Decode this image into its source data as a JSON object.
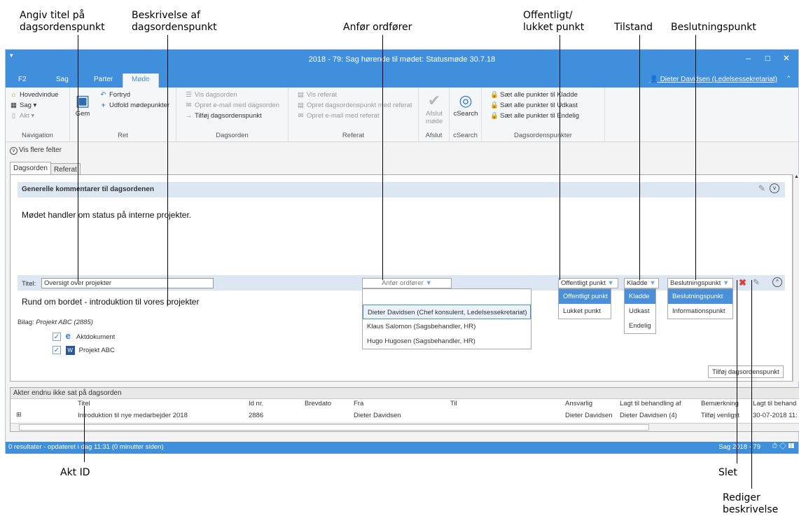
{
  "callouts": {
    "titel": "Angiv titel på\ndagsordenspunkt",
    "beskrivelse": "Beskrivelse af\ndagsordenspunkt",
    "ordforer": "Anfør ordfører",
    "offentligt": "Offentligt/\nlukket punkt",
    "tilstand": "Tilstand",
    "beslutning": "Beslutningspunkt",
    "aktid": "Akt ID",
    "slet": "Slet",
    "rediger": "Rediger\nbeskrivelse"
  },
  "window": {
    "title": "2018 - 79: Sag hørende til mødet: Statusmøde 30.7.18",
    "user": "Dieter Davidsen (Ledelsessekretariat)"
  },
  "tabs": [
    "F2",
    "Sag",
    "Parter",
    "Møde"
  ],
  "ribbon": {
    "navigation": {
      "title": "Navigation",
      "items": [
        "Hovedvindue",
        "Sag ▾",
        "Akt ▾"
      ]
    },
    "ret": {
      "title": "Ret",
      "gem": "Gem",
      "fortryd": "Fortryd",
      "udfold": "Udfold mødepunkter"
    },
    "dagsorden": {
      "title": "Dagsorden",
      "items": [
        "Vis dagsorden",
        "Opret e-mail med dagsorden",
        "Tilføj dagsordenspunkt"
      ]
    },
    "referat": {
      "title": "Referat",
      "items": [
        "Vis referat",
        "Opret dagsordenspunkt med referat",
        "Opret e-mail med referat"
      ]
    },
    "afslut": {
      "title": "Afslut",
      "label1": "Afslut",
      "label2": "møde"
    },
    "csearch": {
      "title": "cSearch",
      "label": "cSearch"
    },
    "punkter": {
      "title": "Dagsordenspunkter",
      "items": [
        "Sæt alle punkter til Kladde",
        "Sæt alle punkter til Udkast",
        "Sæt alle punkter til Endelig"
      ]
    }
  },
  "more_fields": "Vis flere felter",
  "doc_tabs": [
    "Dagsorden",
    "Referat"
  ],
  "general": {
    "header": "Generelle kommentarer til dagsordenen",
    "text": "Mødet handler om status på interne projekter."
  },
  "item": {
    "title_label": "Titel:",
    "title_value": "Oversigt over projekter",
    "ordforer_placeholder": "Anfør ordfører",
    "ordforer_options": [
      "Dieter Davidsen (Chef konsulent, Ledelsessekretariat)",
      "Klaus Salomon (Sagsbehandler, HR)",
      "Hugo Hugosen (Sagsbehandler, HR)"
    ],
    "public_selected": "Offentligt punkt",
    "public_options": [
      "Offentligt punkt",
      "Lukket punkt"
    ],
    "state_selected": "Kladde",
    "state_options": [
      "Kladde",
      "Udkast",
      "Endelig"
    ],
    "decision_selected": "Beslutningspunkt",
    "decision_options": [
      "Beslutningspunkt",
      "Informationspunkt"
    ],
    "description": "Rund om bordet - introduktion til vores projekter",
    "bilag_label": "Bilag:",
    "bilag_value": "Projekt ABC  (2885)",
    "attachments": [
      "Aktdokument",
      "Projekt ABC"
    ],
    "add_button": "Tilføj dagsordenspunkt"
  },
  "grid": {
    "header": "Akter endnu ikke sat på dagsorden",
    "columns": [
      "Titel",
      "Id nr.",
      "Brevdato",
      "Fra",
      "Til",
      "Ansvarlig",
      "Lagt til behandling af",
      "Bemærkning",
      "Lagt til behand"
    ],
    "rows": [
      [
        "Introduktion til nye medarbejder 2018",
        "2886",
        "",
        "Dieter Davidsen",
        "",
        "Dieter Davidsen",
        "Dieter Davidsen (4)",
        "Tilføj venligst",
        "30-07-2018 11:"
      ]
    ]
  },
  "status": {
    "left": "0 resultater - opdateret i dag 11:31 (0 minutter siden)",
    "right": "Sag 2018 - 79"
  },
  "colors": {
    "accent": "#3f8fdc",
    "selected": "#4a90d9",
    "header_band": "#dde7f3"
  }
}
